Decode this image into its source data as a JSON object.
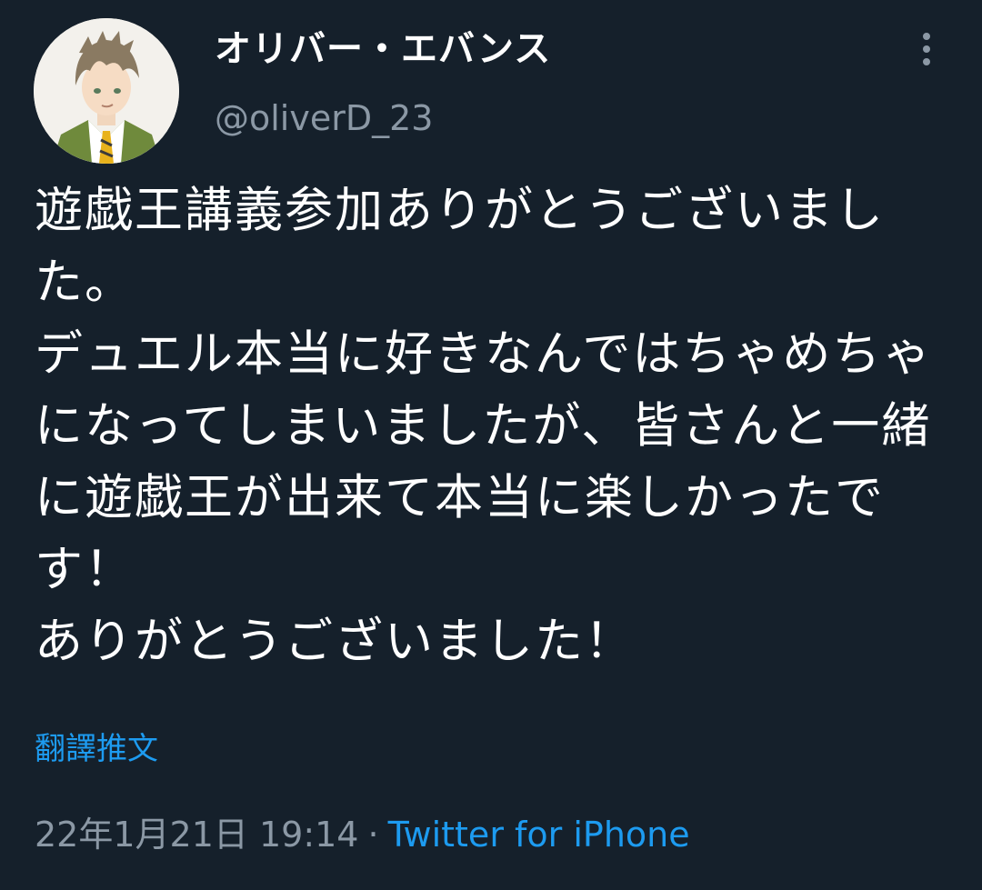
{
  "tweet": {
    "author": {
      "display_name": "オリバー・エバンス",
      "handle": "@oliverD_23"
    },
    "text": "遊戯王講義参加ありがとうございました。\nデュエル本当に好きなんではちゃめちゃになってしまいましたが、皆さんと一緒に遊戯王が出来て本当に楽しかったです！\nありがとうございました！",
    "translate_label": "翻譯推文",
    "timestamp": "22年1月21日 19:14",
    "separator": "·",
    "source": "Twitter for iPhone"
  },
  "icons": {
    "more": "more-vertical-icon",
    "avatar": "avatar-illustration"
  },
  "colors": {
    "background": "#15202b",
    "text_primary": "#ffffff",
    "text_secondary": "#8b98a5",
    "link": "#1d9bf0"
  }
}
